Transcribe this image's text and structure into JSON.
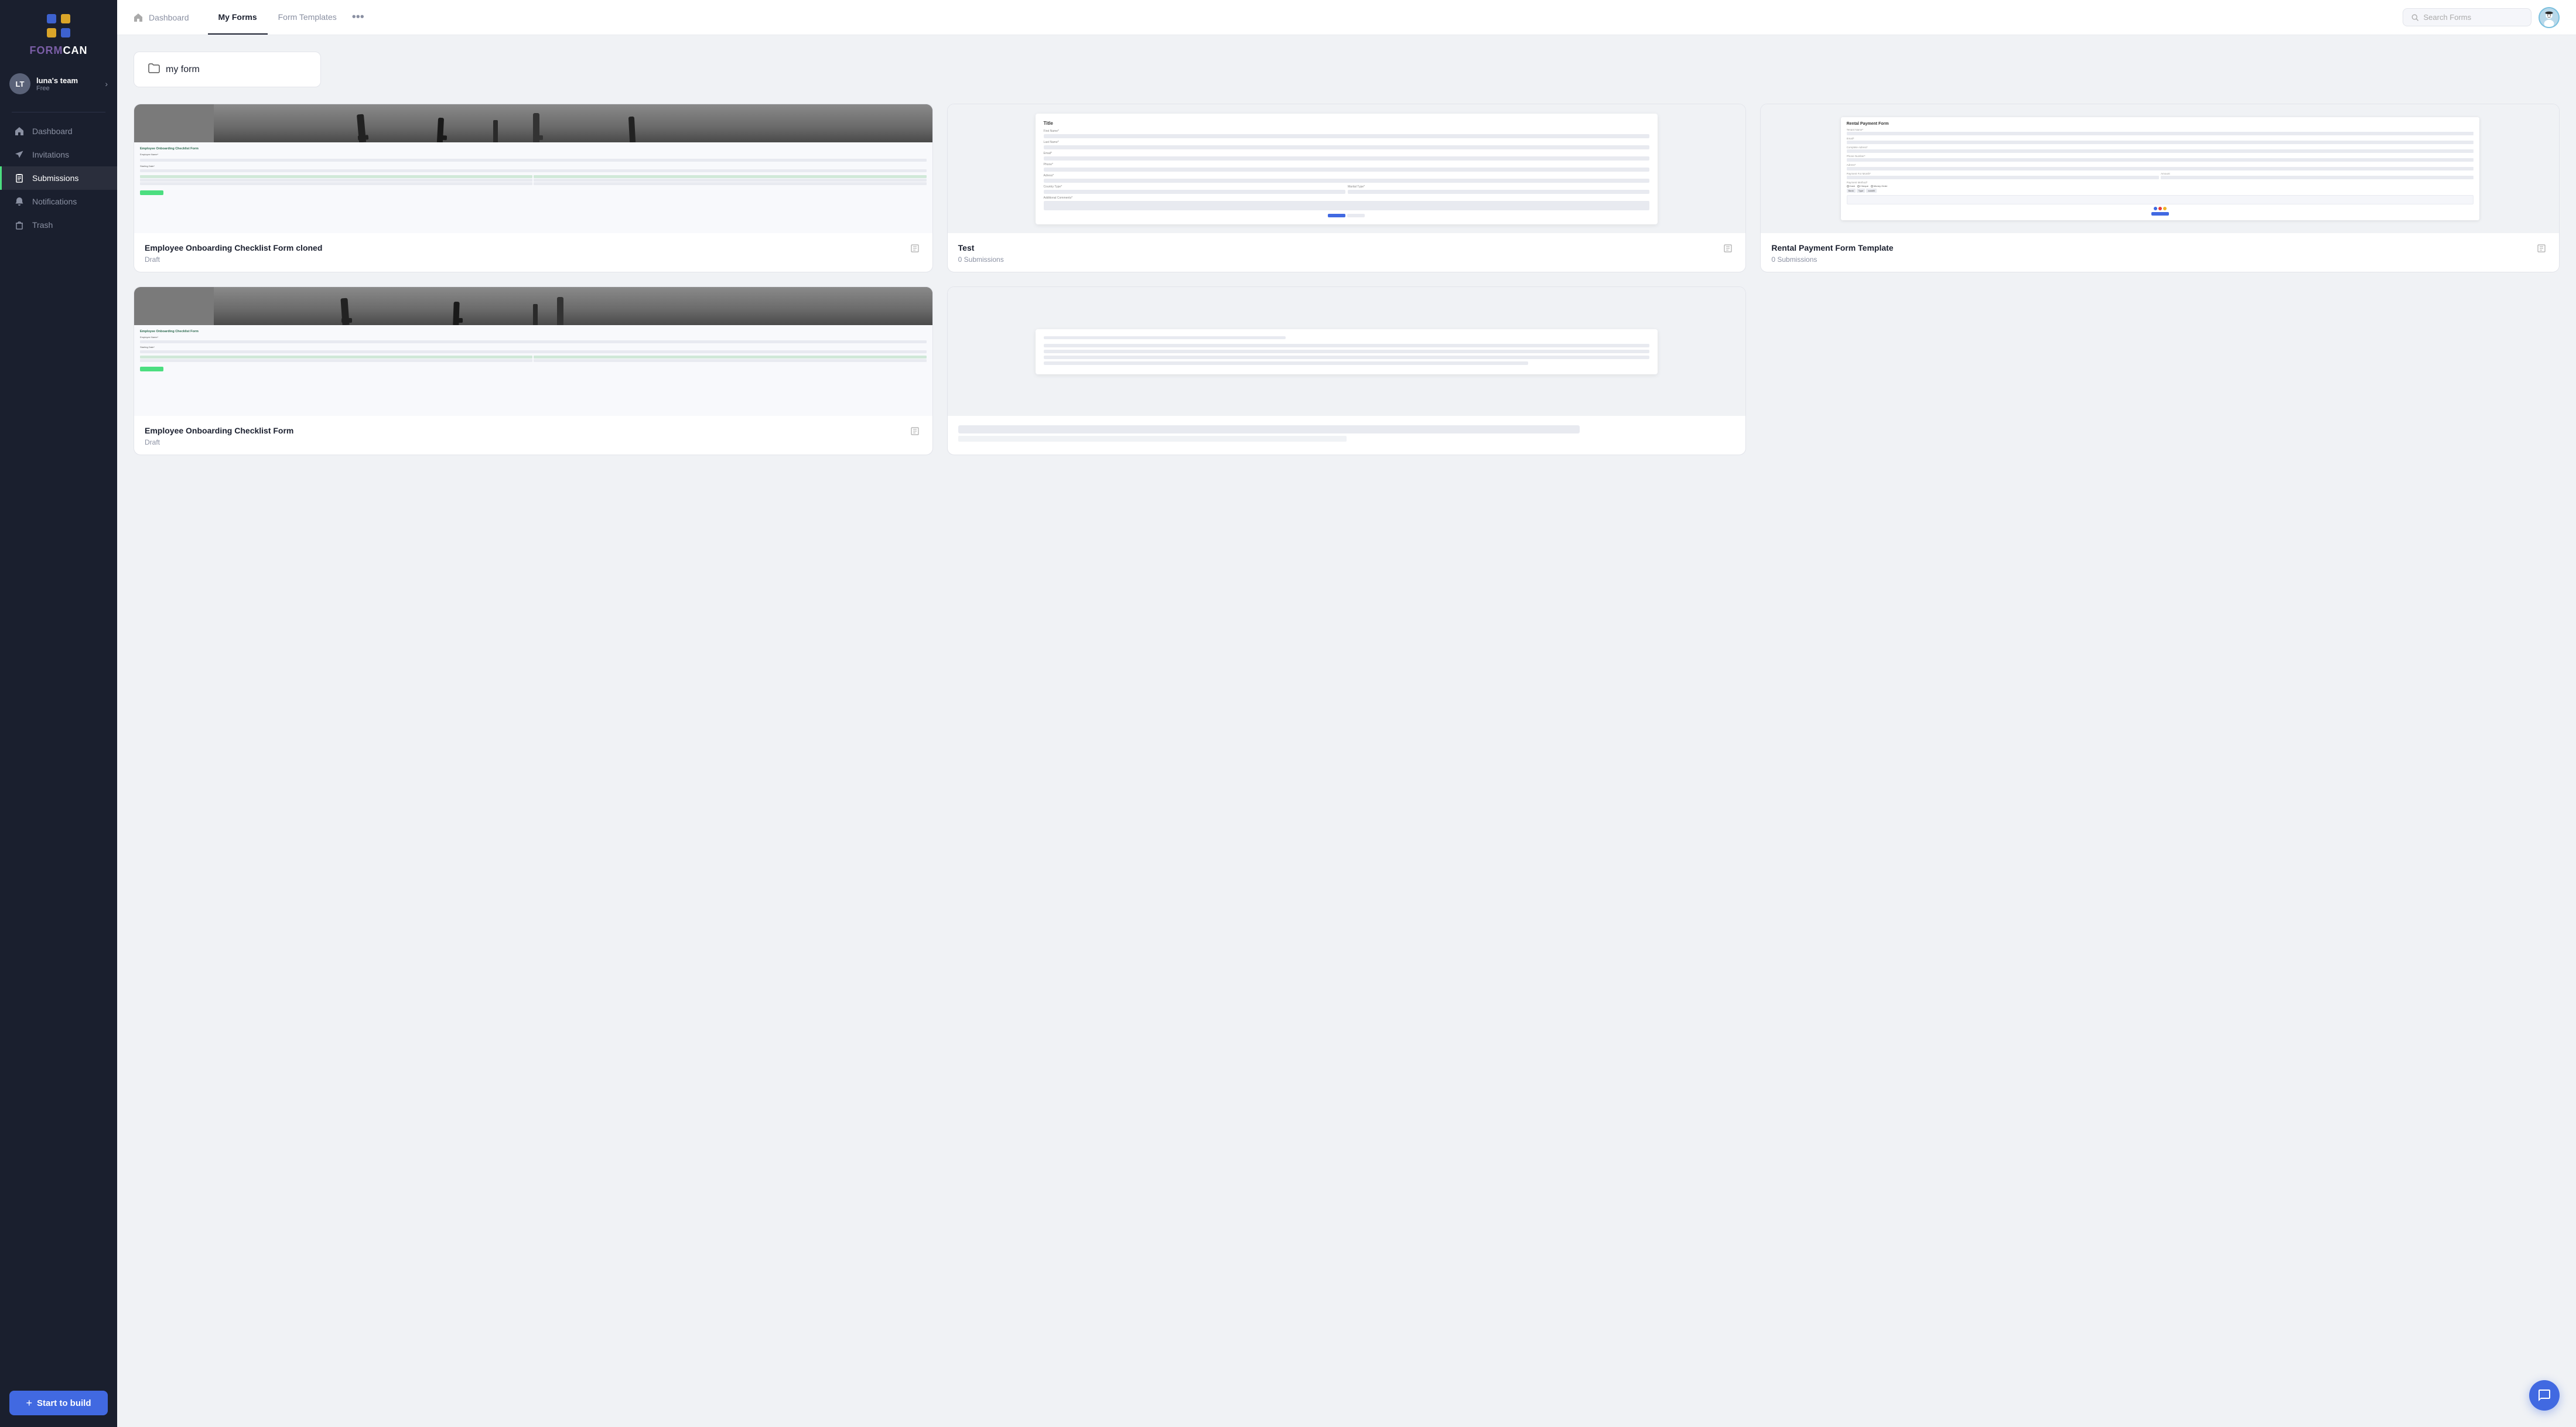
{
  "sidebar": {
    "logo_form": "FORM",
    "logo_can": "CAN",
    "team": {
      "initials": "LT",
      "name": "luna's team",
      "plan": "Free"
    },
    "nav_items": [
      {
        "id": "dashboard",
        "label": "Dashboard",
        "icon": "home"
      },
      {
        "id": "invitations",
        "label": "Invitations",
        "icon": "send"
      },
      {
        "id": "submissions",
        "label": "Submissions",
        "icon": "clipboard",
        "active": true
      },
      {
        "id": "notifications",
        "label": "Notifications",
        "icon": "bell"
      },
      {
        "id": "trash",
        "label": "Trash",
        "icon": "trash"
      }
    ],
    "start_build_label": "Start to build"
  },
  "topnav": {
    "dashboard_label": "Dashboard",
    "tabs": [
      {
        "id": "my-forms",
        "label": "My Forms",
        "active": true
      },
      {
        "id": "form-templates",
        "label": "Form Templates",
        "active": false
      }
    ],
    "search_placeholder": "Search Forms"
  },
  "content": {
    "folder": {
      "label": "my form"
    },
    "forms": [
      {
        "id": "employee-onboarding",
        "title": "Employee Onboarding Checklist Form cloned",
        "subtitle": "Draft",
        "submissions": null,
        "preview_type": "photo-form"
      },
      {
        "id": "test",
        "title": "Test",
        "subtitle": "0 Submissions",
        "submissions": "0 Submissions",
        "preview_type": "form-only"
      },
      {
        "id": "rental-payment",
        "title": "Rental Payment Form Template",
        "subtitle": "0 Submissions",
        "submissions": "0 Submissions",
        "preview_type": "rental-form"
      },
      {
        "id": "employee-onboarding-2",
        "title": "Employee Onboarding Checklist Form",
        "subtitle": "Draft",
        "submissions": null,
        "preview_type": "photo-form"
      },
      {
        "id": "form-5",
        "title": "",
        "subtitle": "",
        "submissions": "",
        "preview_type": "form-only"
      }
    ]
  },
  "chat": {
    "label": "💬"
  }
}
